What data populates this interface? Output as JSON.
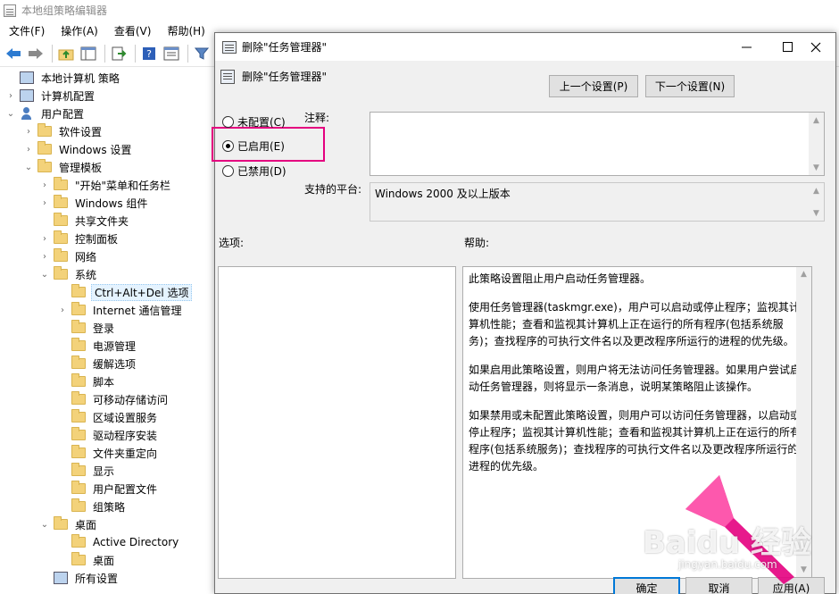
{
  "main_window": {
    "title": "本地组策略编辑器",
    "menu": [
      "文件(F)",
      "操作(A)",
      "查看(V)",
      "帮助(H)"
    ],
    "toolbar_icons": [
      "back-icon",
      "forward-icon",
      "up-folder-icon",
      "show-hide-tree-icon",
      "export-list-icon",
      "help-icon",
      "properties-icon",
      "filter-icon"
    ]
  },
  "tree": {
    "items": [
      {
        "label": "本地计算机 策略",
        "level": 0,
        "icon": "policy-icon",
        "chevron": ""
      },
      {
        "label": "计算机配置",
        "level": 1,
        "icon": "computer-icon",
        "chevron": "›"
      },
      {
        "label": "用户配置",
        "level": 1,
        "icon": "user-icon",
        "chevron": "⌄"
      },
      {
        "label": "软件设置",
        "level": 2,
        "icon": "folder-icon",
        "chevron": "›"
      },
      {
        "label": "Windows 设置",
        "level": 2,
        "icon": "folder-icon",
        "chevron": "›"
      },
      {
        "label": "管理模板",
        "level": 2,
        "icon": "folder-icon",
        "chevron": "⌄"
      },
      {
        "label": "\"开始\"菜单和任务栏",
        "level": 3,
        "icon": "folder-icon",
        "chevron": "›"
      },
      {
        "label": "Windows 组件",
        "level": 3,
        "icon": "folder-icon",
        "chevron": "›"
      },
      {
        "label": "共享文件夹",
        "level": 3,
        "icon": "folder-icon",
        "chevron": ""
      },
      {
        "label": "控制面板",
        "level": 3,
        "icon": "folder-icon",
        "chevron": "›"
      },
      {
        "label": "网络",
        "level": 3,
        "icon": "folder-icon",
        "chevron": "›"
      },
      {
        "label": "系统",
        "level": 3,
        "icon": "folder-icon",
        "chevron": "⌄"
      },
      {
        "label": "Ctrl+Alt+Del 选项",
        "level": 4,
        "icon": "folder-icon",
        "chevron": "",
        "selected": true
      },
      {
        "label": "Internet 通信管理",
        "level": 4,
        "icon": "folder-icon",
        "chevron": "›"
      },
      {
        "label": "登录",
        "level": 4,
        "icon": "folder-icon",
        "chevron": ""
      },
      {
        "label": "电源管理",
        "level": 4,
        "icon": "folder-icon",
        "chevron": ""
      },
      {
        "label": "缓解选项",
        "level": 4,
        "icon": "folder-icon",
        "chevron": ""
      },
      {
        "label": "脚本",
        "level": 4,
        "icon": "folder-icon",
        "chevron": ""
      },
      {
        "label": "可移动存储访问",
        "level": 4,
        "icon": "folder-icon",
        "chevron": ""
      },
      {
        "label": "区域设置服务",
        "level": 4,
        "icon": "folder-icon",
        "chevron": ""
      },
      {
        "label": "驱动程序安装",
        "level": 4,
        "icon": "folder-icon",
        "chevron": ""
      },
      {
        "label": "文件夹重定向",
        "level": 4,
        "icon": "folder-icon",
        "chevron": ""
      },
      {
        "label": "显示",
        "level": 4,
        "icon": "folder-icon",
        "chevron": ""
      },
      {
        "label": "用户配置文件",
        "level": 4,
        "icon": "folder-icon",
        "chevron": ""
      },
      {
        "label": "组策略",
        "level": 4,
        "icon": "folder-icon",
        "chevron": ""
      },
      {
        "label": "桌面",
        "level": 3,
        "icon": "folder-icon",
        "chevron": "⌄"
      },
      {
        "label": "Active Directory",
        "level": 4,
        "icon": "folder-icon",
        "chevron": ""
      },
      {
        "label": "桌面",
        "level": 4,
        "icon": "folder-icon",
        "chevron": ""
      },
      {
        "label": "所有设置",
        "level": 3,
        "icon": "settings-icon",
        "chevron": ""
      }
    ]
  },
  "dialog": {
    "title": "删除\"任务管理器\"",
    "policy_name": "删除\"任务管理器\"",
    "prev_button": "上一个设置(P)",
    "next_button": "下一个设置(N)",
    "radios": [
      {
        "label": "未配置(C)",
        "checked": false
      },
      {
        "label": "已启用(E)",
        "checked": true
      },
      {
        "label": "已禁用(D)",
        "checked": false
      }
    ],
    "comment_label": "注释:",
    "comment_value": "",
    "platform_label": "支持的平台:",
    "platform_value": "Windows 2000 及以上版本",
    "options_label": "选项:",
    "help_label": "帮助:",
    "help_paragraphs": [
      "此策略设置阻止用户启动任务管理器。",
      "使用任务管理器(taskmgr.exe)，用户可以启动或停止程序；监视其计算机性能；查看和监视其计算机上正在运行的所有程序(包括系统服务)；查找程序的可执行文件名以及更改程序所运行的进程的优先级。",
      "如果启用此策略设置，则用户将无法访问任务管理器。如果用户尝试启动任务管理器，则将显示一条消息，说明某策略阻止该操作。",
      "如果禁用或未配置此策略设置，则用户可以访问任务管理器，以启动或停止程序；监视其计算机性能；查看和监视其计算机上正在运行的所有程序(包括系统服务)；查找程序的可执行文件名以及更改程序所运行的进程的优先级。"
    ],
    "ok_button": "确定",
    "cancel_button": "取消",
    "apply_button": "应用(A)"
  },
  "watermark": {
    "text": "Baidu 经验",
    "sub": "jingyan.baidu.com"
  },
  "colors": {
    "highlight": "#e4007f",
    "accent": "#0078d7"
  }
}
